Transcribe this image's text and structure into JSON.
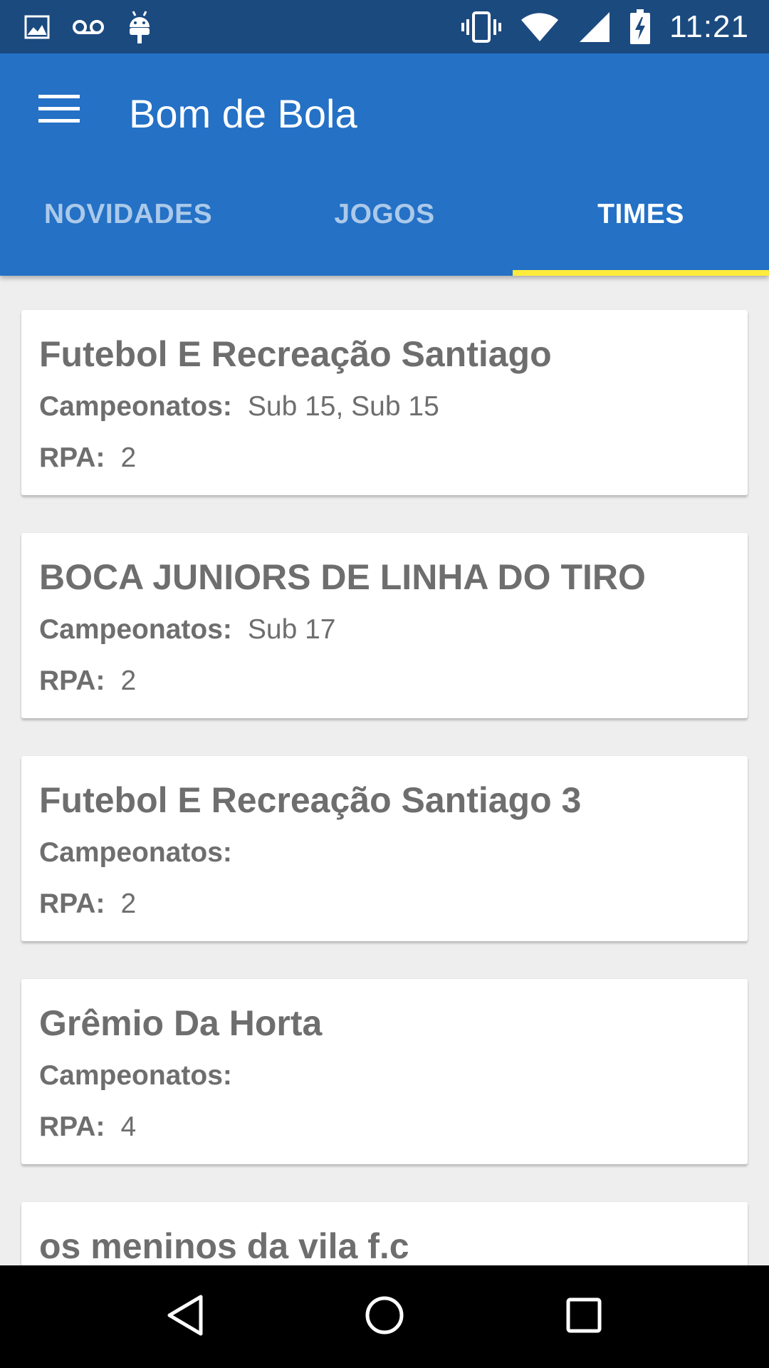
{
  "status_bar": {
    "time": "11:21",
    "left_icons": [
      "image-icon",
      "voicemail-icon",
      "android-icon"
    ],
    "right_icons": [
      "vibrate-icon",
      "wifi-icon",
      "cell-signal-icon",
      "battery-charging-icon"
    ]
  },
  "app_bar": {
    "title": "Bom de Bola",
    "menu_icon": "hamburger-menu-icon",
    "background_color": "#2471c6"
  },
  "tabs": [
    {
      "label": "NOVIDADES",
      "active": false
    },
    {
      "label": "JOGOS",
      "active": false
    },
    {
      "label": "TIMES",
      "active": true
    }
  ],
  "tab_indicator_color": "#ffeb3b",
  "teams": [
    {
      "name": "Futebol E Recreação Santiago",
      "campeonatos_label": "Campeonatos:",
      "campeonatos": "Sub 15, Sub 15",
      "rpa_label": "RPA:",
      "rpa": "2"
    },
    {
      "name": "BOCA JUNIORS DE LINHA DO TIRO",
      "campeonatos_label": "Campeonatos:",
      "campeonatos": "Sub 17",
      "rpa_label": "RPA:",
      "rpa": "2"
    },
    {
      "name": "Futebol E Recreação Santiago 3",
      "campeonatos_label": "Campeonatos:",
      "campeonatos": "",
      "rpa_label": "RPA:",
      "rpa": "2"
    },
    {
      "name": "Grêmio Da Horta",
      "campeonatos_label": "Campeonatos:",
      "campeonatos": "",
      "rpa_label": "RPA:",
      "rpa": "4"
    },
    {
      "name": "os meninos da vila f.c"
    }
  ],
  "nav_bar": {
    "buttons": [
      "back-icon",
      "home-icon",
      "recents-icon"
    ]
  }
}
